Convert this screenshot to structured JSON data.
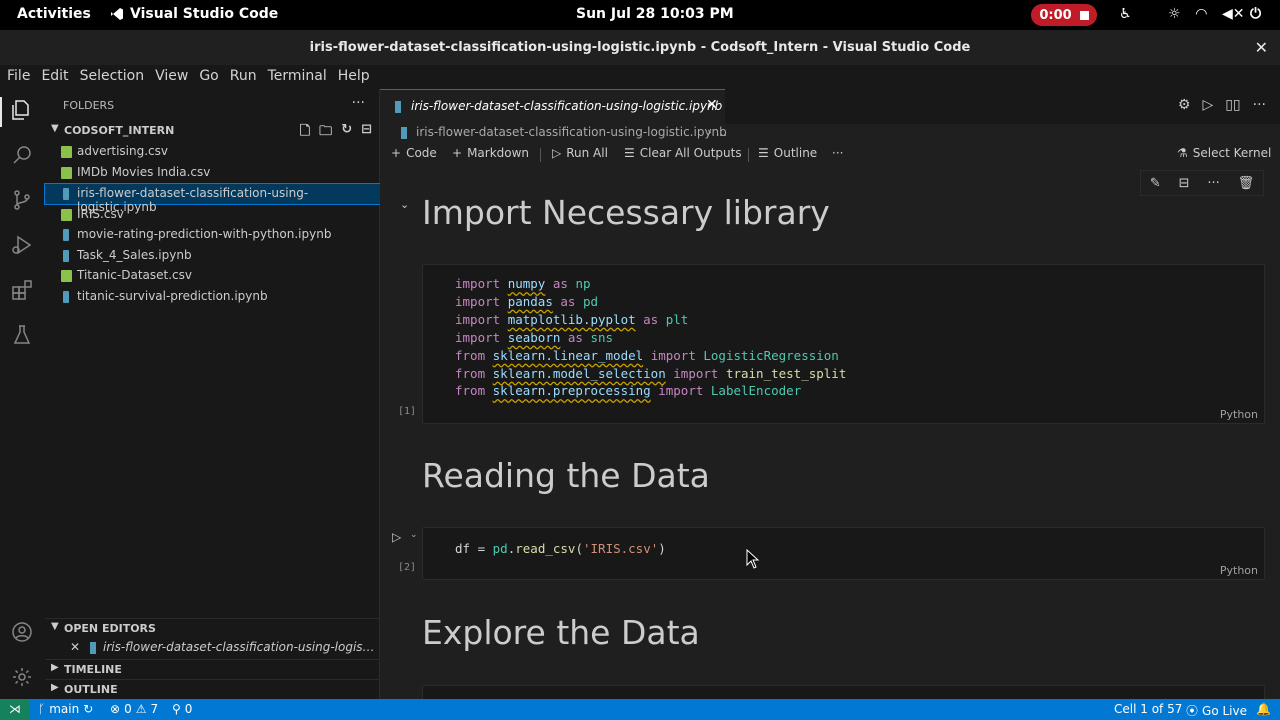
{
  "gnome": {
    "activities": "Activities",
    "app_name": "Visual Studio Code",
    "clock": "Sun Jul 28  10:03 PM",
    "recording": "0:00"
  },
  "window": {
    "title": "iris-flower-dataset-classification-using-logistic.ipynb - Codsoft_Intern - Visual Studio Code",
    "close": "✕"
  },
  "menu": [
    "File",
    "Edit",
    "Selection",
    "View",
    "Go",
    "Run",
    "Terminal",
    "Help"
  ],
  "sidebar": {
    "header": "FOLDERS",
    "more": "···",
    "folder": "CODSOFT_INTERN",
    "files": [
      {
        "name": "advertising.csv",
        "type": "csv"
      },
      {
        "name": "IMDb Movies India.csv",
        "type": "csv"
      },
      {
        "name": "iris-flower-dataset-classification-using-logistic.ipynb",
        "type": "nb"
      },
      {
        "name": "IRIS.csv",
        "type": "csv"
      },
      {
        "name": "movie-rating-prediction-with-python.ipynb",
        "type": "nb"
      },
      {
        "name": "Task_4_Sales.ipynb",
        "type": "nb"
      },
      {
        "name": "Titanic-Dataset.csv",
        "type": "csv"
      },
      {
        "name": "titanic-survival-prediction.ipynb",
        "type": "nb"
      }
    ],
    "open_editors": "OPEN EDITORS",
    "open_editor_file": "iris-flower-dataset-classification-using-logistic.i...",
    "timeline": "TIMELINE",
    "outline": "OUTLINE"
  },
  "tab": {
    "label": "iris-flower-dataset-classification-using-logistic.ipynb",
    "close": "✕"
  },
  "breadcrumb": {
    "file": "iris-flower-dataset-classification-using-logistic.ipynb",
    "sep": "›  ..."
  },
  "toolbar": {
    "code": "Code",
    "markdown": "Markdown",
    "run_all": "Run All",
    "clear_outputs": "Clear All Outputs",
    "outline": "Outline",
    "more": "···",
    "select_kernel": "Select Kernel"
  },
  "notebook": {
    "heading1": "Import Necessary library",
    "heading2": "Reading the Data",
    "heading3": "Explore the Data",
    "cell1_exec": "[1]",
    "cell2_exec": "[2]",
    "lang": "Python"
  },
  "statusbar": {
    "branch": "main",
    "errors": "0",
    "warnings": "7",
    "ports": "0",
    "cell": "Cell 1 of 57",
    "golive": "Go Live"
  }
}
